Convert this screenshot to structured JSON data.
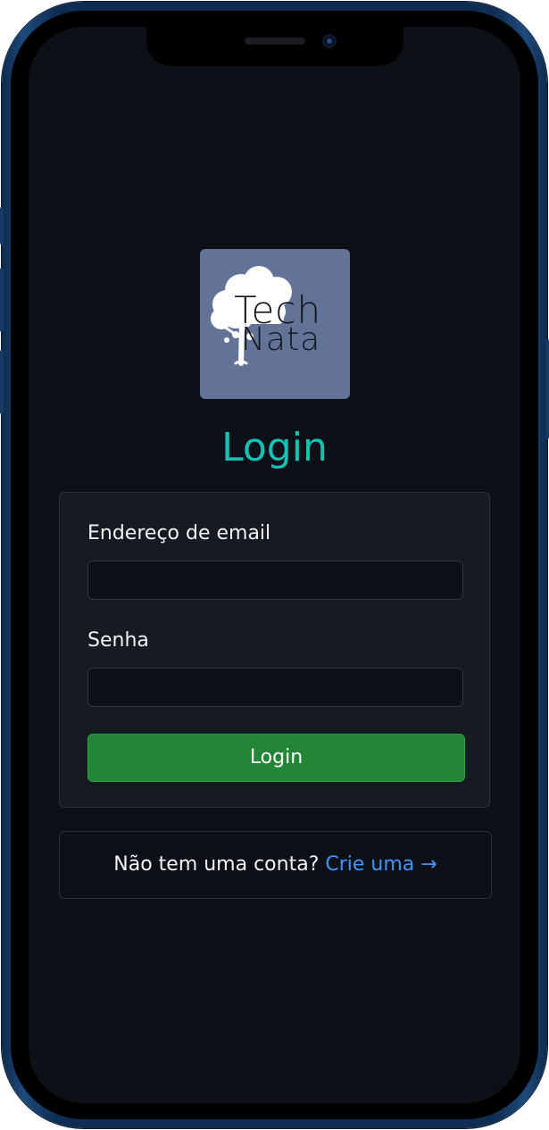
{
  "logo": {
    "line1": "Tech",
    "line2": "Nata",
    "background": "#627397",
    "icon": "tree-icon"
  },
  "page": {
    "title": "Login"
  },
  "form": {
    "email_label": "Endereço de email",
    "email_value": "",
    "password_label": "Senha",
    "password_value": "",
    "submit_label": "Login"
  },
  "signup": {
    "prompt": "Não tem uma conta?",
    "link_label": "Crie uma →"
  },
  "colors": {
    "screen_bg": "#0d1117",
    "title": "#12c2b4",
    "primary_button": "#238636",
    "link": "#4493f8"
  }
}
